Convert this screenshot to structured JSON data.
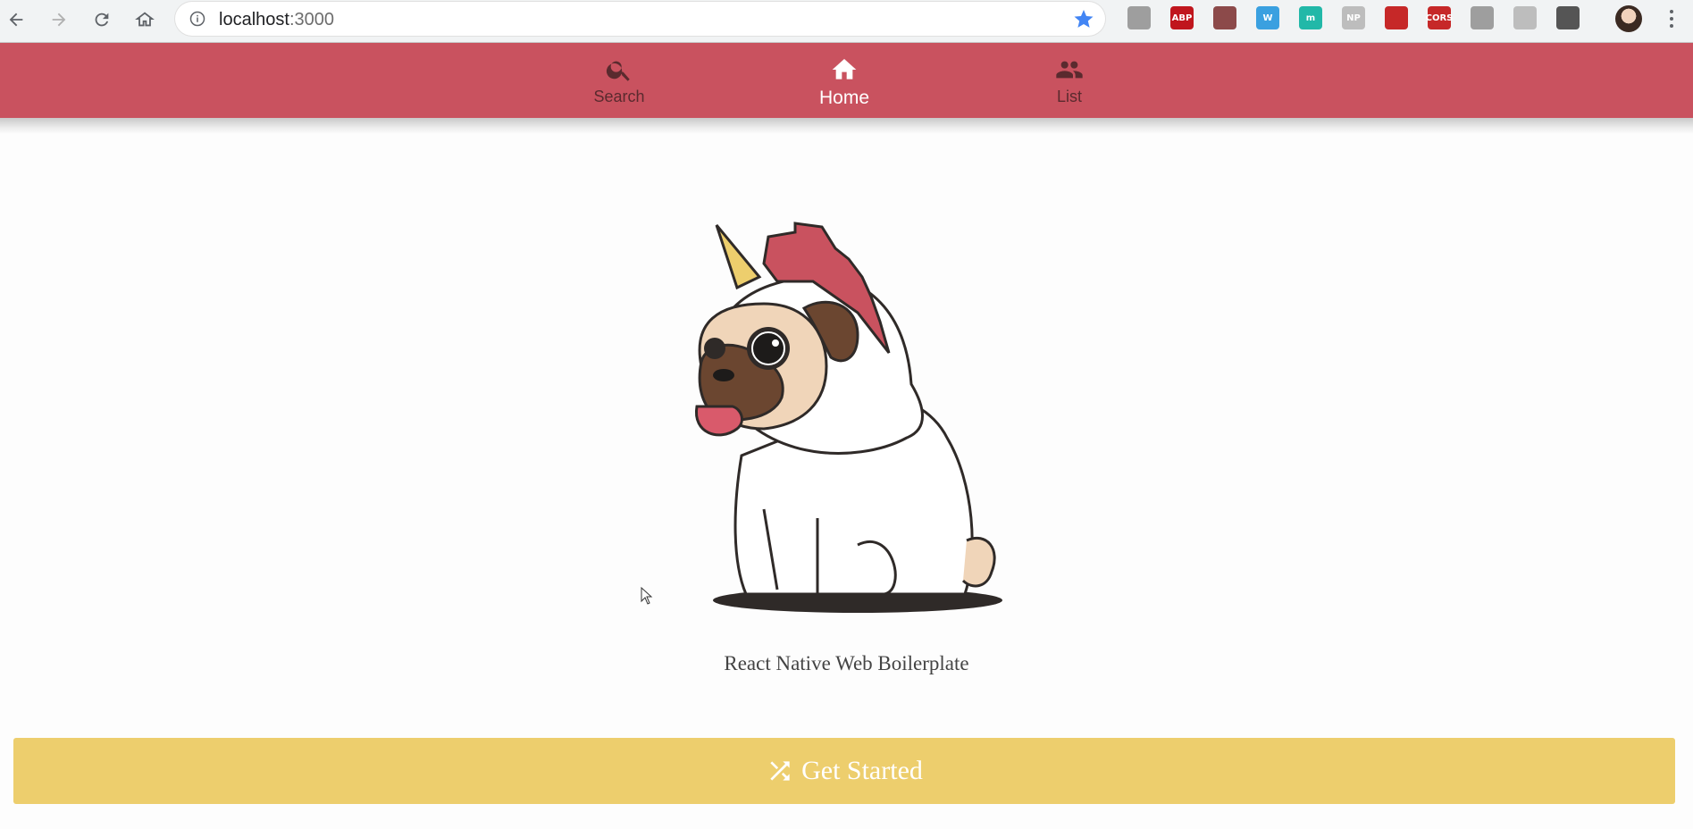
{
  "browser": {
    "url_host": "localhost",
    "url_port": ":3000",
    "nav_icons": [
      "back-icon",
      "forward-icon",
      "reload-icon",
      "home-icon"
    ],
    "extensions": [
      {
        "name": "extension-gray-icon",
        "label": "",
        "color": "#9e9e9e"
      },
      {
        "name": "extension-abp-icon",
        "label": "ABP",
        "color": "#c0161d"
      },
      {
        "name": "extension-pdf-icon",
        "label": "",
        "color": "#8c4a4a"
      },
      {
        "name": "extension-w-icon",
        "label": "W",
        "color": "#3aa0e0"
      },
      {
        "name": "extension-m-icon",
        "label": "m",
        "color": "#22b8a8"
      },
      {
        "name": "extension-np-icon",
        "label": "NP",
        "color": "#bdbdbd"
      },
      {
        "name": "extension-red-icon",
        "label": "",
        "color": "#c62828"
      },
      {
        "name": "extension-cors-icon",
        "label": "CORS",
        "color": "#c62828"
      },
      {
        "name": "extension-dots-icon",
        "label": "",
        "color": "#9e9e9e"
      },
      {
        "name": "extension-camera-icon",
        "label": "",
        "color": "#bdbdbd"
      },
      {
        "name": "extension-basket-icon",
        "label": "",
        "color": "#555555"
      }
    ]
  },
  "tabs": [
    {
      "label": "Search",
      "icon": "search-icon",
      "active": false
    },
    {
      "label": "Home",
      "icon": "home-icon",
      "active": true
    },
    {
      "label": "List",
      "icon": "people-icon",
      "active": false
    }
  ],
  "main": {
    "tagline": "React Native Web Boilerplate",
    "cta_label": "Get Started",
    "cta_icon": "shuffle-icon"
  },
  "colors": {
    "tabbar": "#c9525f",
    "cta": "#edce6d",
    "inactive_tab": "#5a2a2e"
  }
}
